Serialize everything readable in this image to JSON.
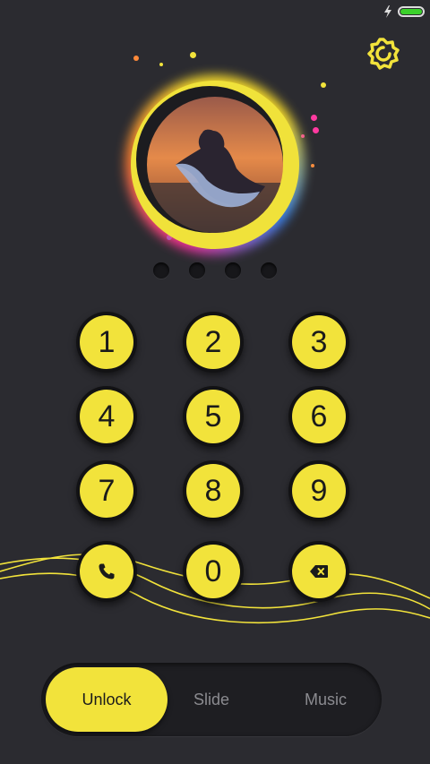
{
  "accent_color": "#f2e33b",
  "status_bar": {
    "charging_icon": "bolt-icon",
    "battery_level": 1.0
  },
  "header": {
    "settings_icon": "gear-icon"
  },
  "profile": {
    "photo": "silhouette-dancer-photo"
  },
  "pin": {
    "length": 4,
    "entered": 0
  },
  "keypad": {
    "keys": [
      "1",
      "2",
      "3",
      "4",
      "5",
      "6",
      "7",
      "8",
      "9"
    ],
    "zero": "0",
    "call_icon": "phone-icon",
    "delete_icon": "backspace-icon"
  },
  "tabs": {
    "unlock": "Unlock",
    "slide": "Slide",
    "music": "Music",
    "active": "Unlock"
  }
}
